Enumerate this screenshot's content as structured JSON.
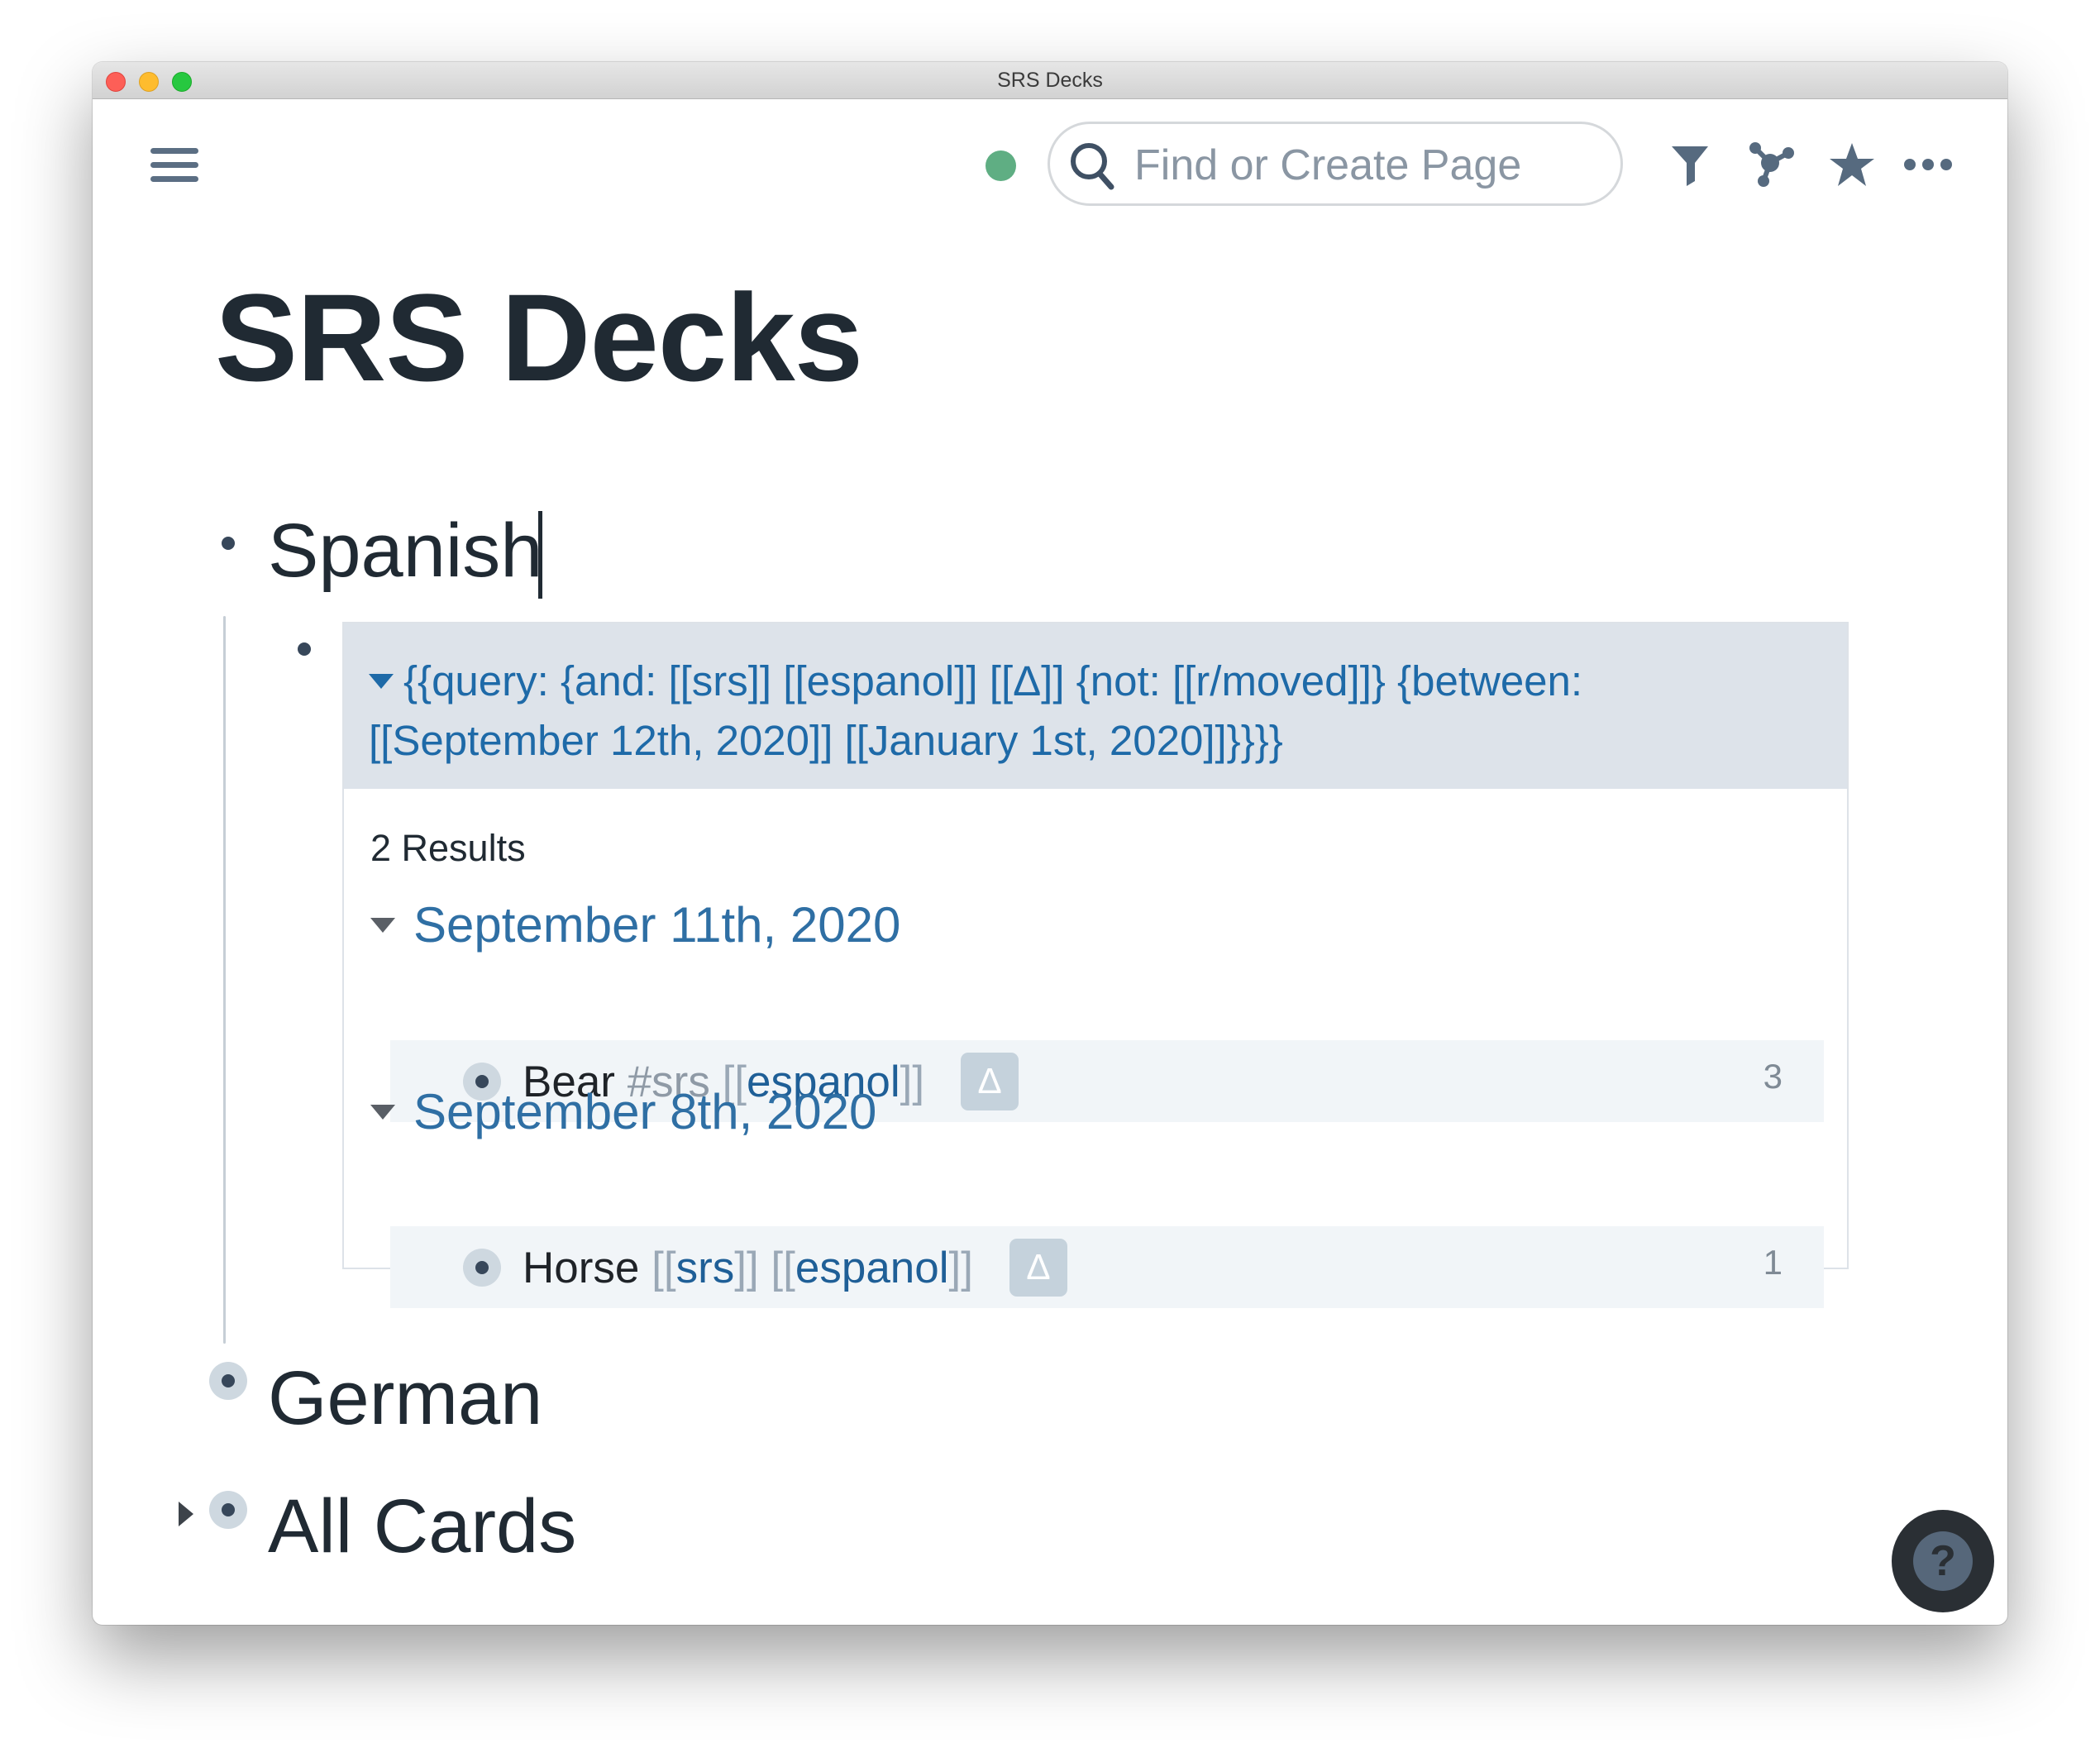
{
  "window": {
    "title": "SRS Decks"
  },
  "topbar": {
    "search": {
      "placeholder": "Find or Create Page",
      "value": ""
    },
    "status_color": "#5fae83",
    "icons": [
      "menu-icon",
      "search-icon",
      "filter-icon",
      "graph-icon",
      "star-icon",
      "more-icon"
    ]
  },
  "page": {
    "title": "SRS Decks",
    "blocks": [
      {
        "text": "Spanish",
        "child": {
          "query": {
            "text": "{{query:  {and: [[srs]] [[espanol]] [[Δ]] {not: [[r/moved]]} {between: [[September 12th, 2020]] [[January 1st, 2020]]}}}}",
            "results_label": "2 Results",
            "groups": [
              {
                "title": "September 11th, 2020",
                "rows": [
                  {
                    "word": "Bear",
                    "tag": "#srs",
                    "link_open": "[[",
                    "link": "espanol",
                    "link_close": "]]",
                    "badge": "Δ",
                    "count": "3"
                  }
                ]
              },
              {
                "title": "September 8th, 2020",
                "rows": [
                  {
                    "word": "Horse",
                    "ref1_open": "[[",
                    "ref1": "srs",
                    "ref1_close": "]]",
                    "link_open": "[[",
                    "link": "espanol",
                    "link_close": "]]",
                    "badge": "Δ",
                    "count": "1"
                  }
                ]
              }
            ]
          }
        }
      },
      {
        "text": "German"
      },
      {
        "text": "All Cards",
        "collapsed": true
      }
    ]
  },
  "help": {
    "label": "?"
  }
}
